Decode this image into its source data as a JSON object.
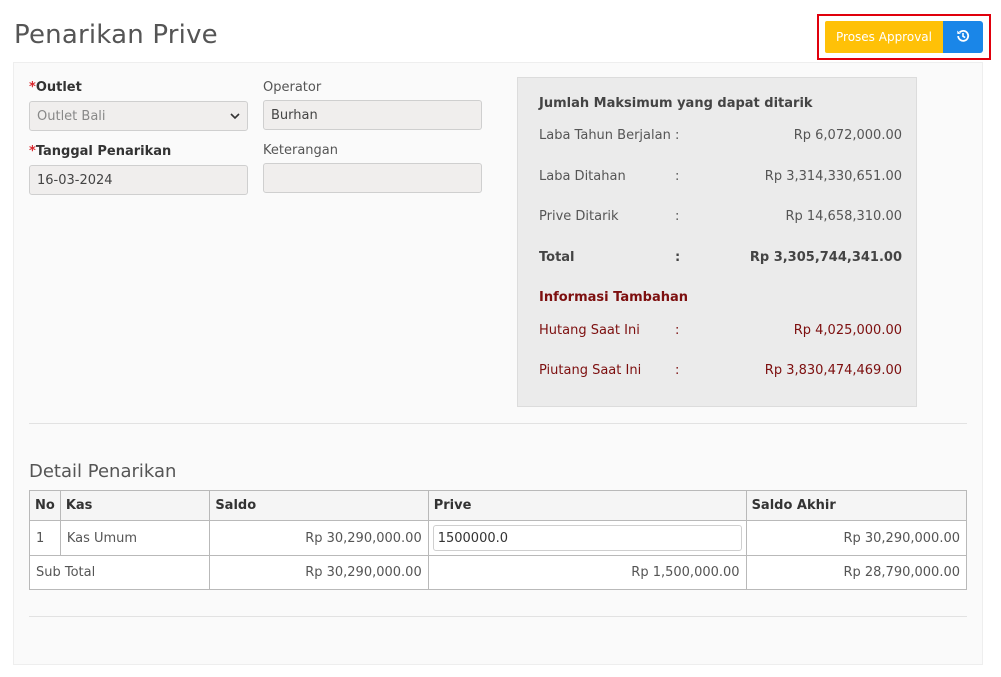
{
  "page": {
    "title": "Penarikan Prive"
  },
  "actions": {
    "approval_label": "Proses Approval",
    "refresh_icon": "history-icon"
  },
  "form": {
    "outlet": {
      "required_mark": "*",
      "label": "Outlet",
      "value": "Outlet Bali"
    },
    "operator": {
      "label": "Operator",
      "value": "Burhan"
    },
    "tanggal": {
      "required_mark": "*",
      "label": "Tanggal Penarikan",
      "value": "16-03-2024"
    },
    "keterangan": {
      "label": "Keterangan",
      "value": ""
    }
  },
  "summary": {
    "heading": "Jumlah Maksimum yang dapat ditarik",
    "rows": [
      {
        "label": "Laba Tahun Berjalan",
        "colon": ":",
        "value": "Rp 6,072,000.00"
      },
      {
        "label": "Laba Ditahan",
        "colon": ":",
        "value": "Rp 3,314,330,651.00"
      },
      {
        "label": "Prive Ditarik",
        "colon": ":",
        "value": "Rp 14,658,310.00"
      },
      {
        "label": "Total",
        "colon": ":",
        "value": "Rp 3,305,744,341.00"
      }
    ],
    "extra_heading": "Informasi Tambahan",
    "extra_rows": [
      {
        "label": "Hutang Saat Ini",
        "colon": ":",
        "value": "Rp 4,025,000.00"
      },
      {
        "label": "Piutang Saat Ini",
        "colon": ":",
        "value": "Rp 3,830,474,469.00"
      }
    ]
  },
  "detail": {
    "title": "Detail Penarikan",
    "columns": [
      "No",
      "Kas",
      "Saldo",
      "Prive",
      "Saldo Akhir"
    ],
    "rows": [
      {
        "no": "1",
        "kas": "Kas Umum",
        "saldo": "Rp 30,290,000.00",
        "prive": "1500000.0",
        "saldo_akhir": "Rp 30,290,000.00"
      }
    ],
    "subtotal": {
      "label": "Sub Total",
      "saldo": "Rp 30,290,000.00",
      "prive": "Rp 1,500,000.00",
      "saldo_akhir": "Rp 28,790,000.00"
    }
  }
}
